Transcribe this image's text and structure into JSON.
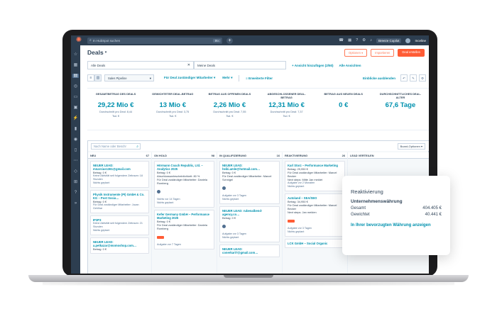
{
  "topbar": {
    "search_placeholder": "In HubSpot suchen",
    "kbd": "⌘K",
    "upgrade": "Upgrade",
    "copilot": "Breeze Copilot",
    "portal": "Inceline"
  },
  "header": {
    "title": "Deals",
    "actions_label": "Optionen ▾",
    "import_label": "Importieren",
    "create_label": "Deal erstellen"
  },
  "views": {
    "tab1": "Alle Deals",
    "tab2": "Meine Deals",
    "add_view": "+ Ansicht hinzufügen (2/50)",
    "all_views": "Alle Ansichten"
  },
  "filters": {
    "pipeline": "Sales Pipeline",
    "owner": "Für Deal zuständiger Mitarbeiter ▾",
    "more": "Mehr ▾",
    "advanced": "≡ Erweiterte Filter",
    "display": "Einblicke ausblenden"
  },
  "stats": [
    {
      "label": "GESAMTBETRAG DES DEALS",
      "value": "29,22 Mio €",
      "sub": "Durchschnitt pro Deal: 8,44",
      "sub2": "Tsd. €"
    },
    {
      "label": "GEWICHTETER DEAL-BETRAG",
      "value": "13 Mio €",
      "sub": "Durchschnitt pro Deal: 3,75",
      "sub2": "Tsd. €"
    },
    {
      "label": "BETRAG AUS OFFENEN DEALS",
      "value": "2,26 Mio €",
      "sub": "Durchschnitt pro Deal: 7,55",
      "sub2": "Tsd. €"
    },
    {
      "label": "ABGESCHLOSSENER DEAL-BETRAG",
      "value": "12,31 Mio €",
      "sub": "Durchschnitt pro Deal: 7,37",
      "sub2": "Tsd. €"
    },
    {
      "label": "BETRAG AUS NEUEN DEALS",
      "value": "0 €",
      "sub": "",
      "sub2": ""
    },
    {
      "label": "DURCHSCHNITTLICHES DEAL-ALTER",
      "value": "67,6 Tage",
      "sub": "",
      "sub2": ""
    }
  ],
  "board": {
    "search_placeholder": "Nach Name oder Beschr",
    "options": "Board-Optionen ▾",
    "columns": [
      {
        "name": "NEU",
        "count": "67"
      },
      {
        "name": "ON HOLD",
        "count": "98"
      },
      {
        "name": "IN QUALIFIZIERUNG",
        "count": "16"
      },
      {
        "name": "REAKTIVIERUNG",
        "count": "26"
      },
      {
        "name": "LEAD VERTEILEN",
        "count": ""
      }
    ],
    "col1": [
      {
        "name": "NEUER LEAD: mnarsius1361@gmail.com",
        "l1": "Betrag: 0 €",
        "l2": "Keine Aktivität seit folgendem Zeitraum: 18 Stunden",
        "l3": "Nichts geplant"
      },
      {
        "name": "Physik Instrumente (PI) GmbH & Co. KG – Post Socia…",
        "l1": "Betrag: 0 €",
        "l2": "Für Deal zuständiger Mitarbeiter: Jucan Gehlhar",
        "l3": ""
      },
      {
        "name": "IP3P3",
        "l1": "Keine Aktivität seit folgendem Zeitraum: 21 Stunden",
        "l2": "Nichts geplant",
        "l3": ""
      },
      {
        "name": "NEUER LEAD: a.petkazar@momoshop.com…",
        "l1": "Betrag: 0 €",
        "l2": "",
        "l3": ""
      }
    ],
    "col2": [
      {
        "name": "Hörmann Coach Republic, Ltd. – Analytics 2025",
        "l1": "Betrag: 0 €",
        "l2": "Abschlusswahrscheinlichkeit: 80 %",
        "l3": "Für Deal zuständiger Mitarbeiter: Daniela Romberg"
      },
      {
        "name": "",
        "l1": "Nichts vor 14 Tagen",
        "l2": "Nichts geplant",
        "l3": ""
      },
      {
        "name": "Kefer Germany GmbH – Performance Marketing 2025",
        "l1": "Betrag: 0 €",
        "l2": "Für Deal zuständiger Mitarbeiter: Daniela Romberg",
        "l3": "Aufgabe vor 7 Tagen"
      }
    ],
    "col3": [
      {
        "name": "NEUER LEAD: heiki.amle@hotmail.com…",
        "l1": "Betrag: 0 €",
        "l2": "Für Deal zuständiger Mitarbeiter: Marcel Schnigel",
        "l3": ""
      },
      {
        "name": "",
        "l1": "Aufgabe vor 3 Tagen",
        "l2": "Nichts geplant",
        "l3": ""
      },
      {
        "name": "NEUER LEAD: rubenalbend-agency.co…",
        "l1": "Betrag: 0 €",
        "l2": "Aufgabe vor 3 Tagen",
        "l3": "Nichts geplant"
      },
      {
        "name": "NEUER LEAD: conerkart7@gmail.com…",
        "l1": "",
        "l2": "",
        "l3": ""
      }
    ],
    "col4": [
      {
        "name": "Karl Storz – Performance Marketing",
        "l1": "Betrag: 29,950 €",
        "l2": "Für Deal zuständiger Mitarbeiter: Marcel Becker",
        "l3": "Next steps: Mitte Jan meldet"
      },
      {
        "name": "",
        "l1": "Aufgabe vor 2 Monaten",
        "l2": "Nichts geplant",
        "l3": ""
      },
      {
        "name": "Autoland – SEA/SEO",
        "l1": "Betrag: 34,950 €",
        "l2": "Für Deal zuständiger Mitarbeiter: Marcel Becker",
        "l3": "Next steps: Jan melden"
      },
      {
        "name": "",
        "l1": "Aufgabe vor 3 Tagen",
        "l2": "Nichts geplant",
        "l3": ""
      },
      {
        "name": "LCK GmbH – Social Organic",
        "l1": "",
        "l2": "",
        "l3": ""
      }
    ]
  },
  "popover": {
    "title": "Reaktivierung",
    "subtitle": "Unternehmenswährung",
    "row1_label": "Gesamt",
    "row1_value": "404.405 €",
    "row2_label": "Gewichtet",
    "row2_value": "40.441 €",
    "link": "In Ihrer bevorzugten Währung anzeigen"
  },
  "colors": {
    "accent": "#ff7a59",
    "link": "#0091ae",
    "nav": "#2d3e50"
  }
}
